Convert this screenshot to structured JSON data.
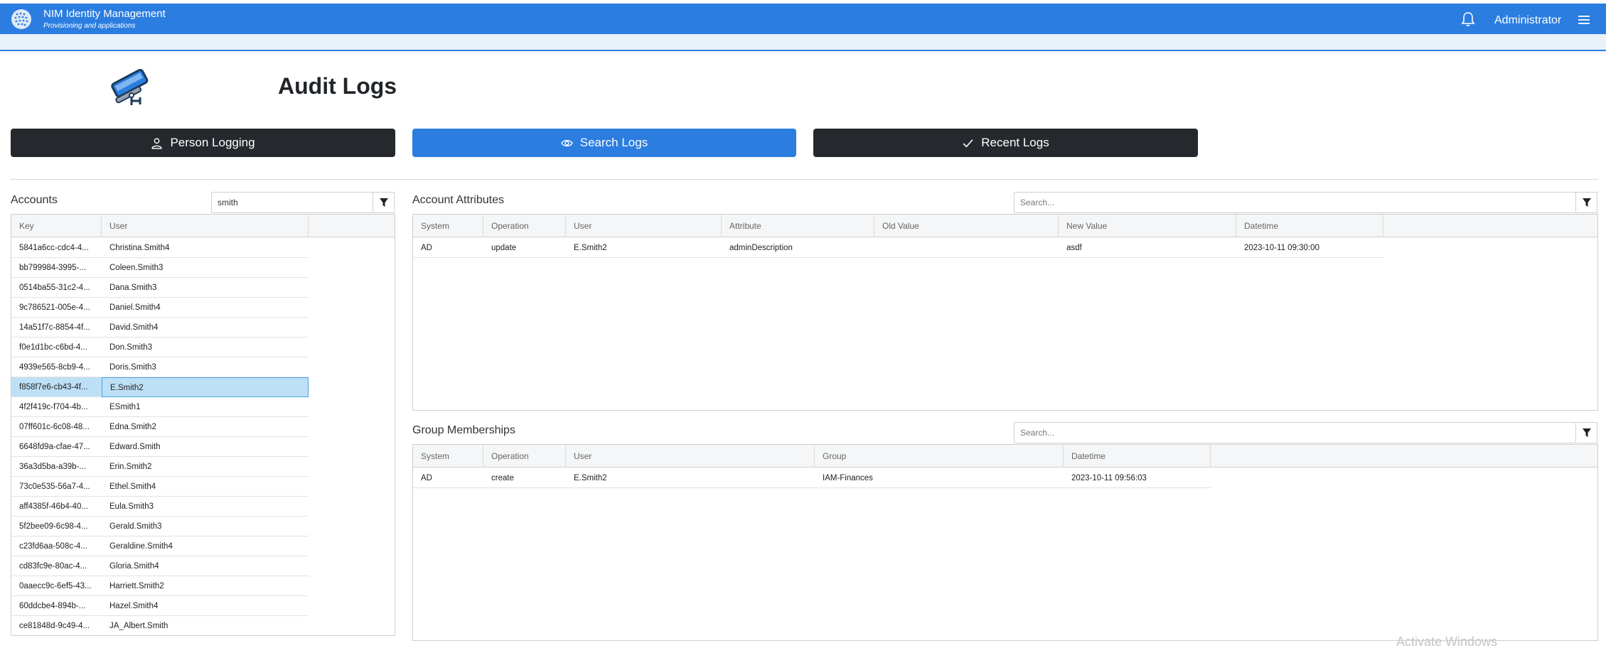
{
  "app": {
    "title": "NIM Identity Management",
    "subtitle": "Provisioning and applications",
    "user": "Administrator",
    "icons": {
      "logo": "globe-logo-icon",
      "bell": "bell-icon",
      "menu": "hamburger-menu-icon",
      "camera": "security-camera-icon"
    }
  },
  "page": {
    "title": "Audit Logs"
  },
  "buttons": [
    {
      "label": "Person Logging",
      "icon": "person-icon",
      "active": false
    },
    {
      "label": "Search Logs",
      "icon": "eye-icon",
      "active": true
    },
    {
      "label": "Recent Logs",
      "icon": "check-icon",
      "active": false
    }
  ],
  "accounts": {
    "label": "Accounts",
    "search_value": "smith",
    "columns": [
      "Key",
      "User"
    ],
    "rows": [
      [
        "5841a6cc-cdc4-4...",
        "Christina.Smith4"
      ],
      [
        "bb799984-3995-...",
        "Coleen.Smith3"
      ],
      [
        "0514ba55-31c2-4...",
        "Dana.Smith3"
      ],
      [
        "9c786521-005e-4...",
        "Daniel.Smith4"
      ],
      [
        "14a51f7c-8854-4f...",
        "David.Smith4"
      ],
      [
        "f0e1d1bc-c6bd-4...",
        "Don.Smith3"
      ],
      [
        "4939e565-8cb9-4...",
        "Doris.Smith3"
      ],
      [
        "f858f7e6-cb43-4f...",
        "E.Smith2"
      ],
      [
        "4f2f419c-f704-4b...",
        "ESmith1"
      ],
      [
        "07ff601c-6c08-48...",
        "Edna.Smith2"
      ],
      [
        "6648fd9a-cfae-47...",
        "Edward.Smith"
      ],
      [
        "36a3d5ba-a39b-...",
        "Erin.Smith2"
      ],
      [
        "73c0e535-56a7-4...",
        "Ethel.Smith4"
      ],
      [
        "aff4385f-46b4-40...",
        "Eula.Smith3"
      ],
      [
        "5f2bee09-6c98-4...",
        "Gerald.Smith3"
      ],
      [
        "c23fd6aa-508c-4...",
        "Geraldine.Smith4"
      ],
      [
        "cd83fc9e-80ac-4...",
        "Gloria.Smith4"
      ],
      [
        "0aaecc9c-6ef5-43...",
        "Harriett.Smith2"
      ],
      [
        "60ddcbe4-894b-...",
        "Hazel.Smith4"
      ],
      [
        "ce81848d-9c49-4...",
        "JA_Albert.Smith"
      ]
    ],
    "selected_index": 7
  },
  "attributes": {
    "label": "Account Attributes",
    "search_placeholder": "Search...",
    "columns": [
      "System",
      "Operation",
      "User",
      "Attribute",
      "Old Value",
      "New Value",
      "Datetime"
    ],
    "rows": [
      [
        "AD",
        "update",
        "E.Smith2",
        "adminDescription",
        "",
        "asdf",
        "2023-10-11 09:30:00"
      ]
    ]
  },
  "groups": {
    "label": "Group Memberships",
    "search_placeholder": "Search...",
    "columns": [
      "System",
      "Operation",
      "User",
      "Group",
      "Datetime"
    ],
    "rows": [
      [
        "AD",
        "create",
        "E.Smith2",
        "IAM-Finances",
        "2023-10-11 09:56:03"
      ]
    ]
  },
  "watermark": "Activate Windows"
}
